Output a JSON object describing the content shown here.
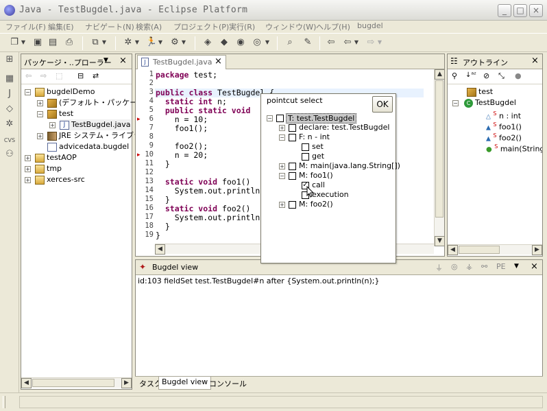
{
  "window": {
    "title": "Java - TestBugdel.java - Eclipse Platform",
    "controls": [
      "_",
      "□",
      "×"
    ]
  },
  "menu": [
    "ファイル(F)",
    "編集(E)",
    "ナビゲート(N)",
    "検索(A)",
    "プロジェクト(P)",
    "実行(R)",
    "ウィンドウ(W)",
    "ヘルプ(H)",
    "bugdel"
  ],
  "package_explorer": {
    "title": "パッケージ・..プローラー",
    "tree": [
      {
        "label": "bugdelDemo",
        "icon": "project-icon",
        "expander": "−"
      },
      {
        "label": "(デフォルト・パッケージ",
        "icon": "package-icon",
        "expander": "+"
      },
      {
        "label": "test",
        "icon": "package-icon",
        "expander": "−"
      },
      {
        "label": "TestBugdel.java",
        "icon": "java-file-icon",
        "expander": "+"
      },
      {
        "label": "JRE システム・ライブラ",
        "icon": "library-icon",
        "expander": "+"
      },
      {
        "label": "advicedata.bugdel",
        "icon": "file-icon",
        "expander": ""
      },
      {
        "label": "testAOP",
        "icon": "project-icon",
        "expander": "+"
      },
      {
        "label": "tmp",
        "icon": "project-icon",
        "expander": "+"
      },
      {
        "label": "xerces-src",
        "icon": "project-icon",
        "expander": "+"
      }
    ]
  },
  "editor": {
    "tab": "TestBugdel.java",
    "line_numbers": [
      "1",
      "2",
      "3",
      "4",
      "5",
      "6",
      "7",
      "8",
      "9",
      "10",
      "11",
      "12",
      "13",
      "14",
      "15",
      "16",
      "17",
      "18",
      "19"
    ],
    "lines": [
      {
        "kw": "package",
        "rest": " test;"
      },
      {
        "kw": "",
        "rest": ""
      },
      {
        "kw": "public class",
        "rest": " TestBugdel {"
      },
      {
        "kw": "  static int",
        "rest": " n;"
      },
      {
        "kw": "  public static void",
        "rest": ""
      },
      {
        "kw": "",
        "rest": "    n = 10;"
      },
      {
        "kw": "",
        "rest": "    foo1();"
      },
      {
        "kw": "",
        "rest": ""
      },
      {
        "kw": "",
        "rest": "    foo2();"
      },
      {
        "kw": "",
        "rest": "    n = 20;"
      },
      {
        "kw": "",
        "rest": "  }"
      },
      {
        "kw": "",
        "rest": ""
      },
      {
        "kw": "  static void",
        "rest": " foo1()"
      },
      {
        "kw": "",
        "rest": "    System.out.println"
      },
      {
        "kw": "",
        "rest": "  }"
      },
      {
        "kw": "  static void",
        "rest": " foo2()"
      },
      {
        "kw": "",
        "rest": "    System.out.println"
      },
      {
        "kw": "",
        "rest": "  }"
      },
      {
        "kw": "",
        "rest": "}"
      }
    ]
  },
  "pointcut_dialog": {
    "title": "pointcut select",
    "ok": "OK",
    "tree": [
      {
        "label": "T: test.TestBugdel",
        "expander": "−",
        "checked": false
      },
      {
        "label": "declare: test.TestBugdel",
        "expander": "+",
        "checked": false
      },
      {
        "label": "F: n - int",
        "expander": "−",
        "checked": false
      },
      {
        "label": "set",
        "expander": "",
        "checked": false
      },
      {
        "label": "get",
        "expander": "",
        "checked": false
      },
      {
        "label": "M: main(java.lang.String[])",
        "expander": "+",
        "checked": false
      },
      {
        "label": "M: foo1()",
        "expander": "−",
        "checked": false
      },
      {
        "label": "call",
        "expander": "",
        "checked": true
      },
      {
        "label": "execution",
        "expander": "",
        "checked": false
      },
      {
        "label": "M: foo2()",
        "expander": "+",
        "checked": false
      }
    ]
  },
  "outline": {
    "title": "アウトライン",
    "tree": [
      {
        "label": "test",
        "icon": "package-icon"
      },
      {
        "label": "TestBugdel",
        "icon": "class-icon"
      },
      {
        "label": "n : int",
        "icon": "field-icon"
      },
      {
        "label": "foo1()",
        "icon": "method-icon"
      },
      {
        "label": "foo2()",
        "icon": "method-icon"
      },
      {
        "label": "main(String",
        "icon": "public-method-icon"
      }
    ]
  },
  "bugdel_view": {
    "title": "Bugdel view",
    "pe_label": "PE",
    "content": "id:103 fieldSet test.TestBugdel#n after {System.out.println(n);}"
  },
  "bottom_tabs": [
    "タスク",
    "Bugdel view",
    "コンソール"
  ]
}
